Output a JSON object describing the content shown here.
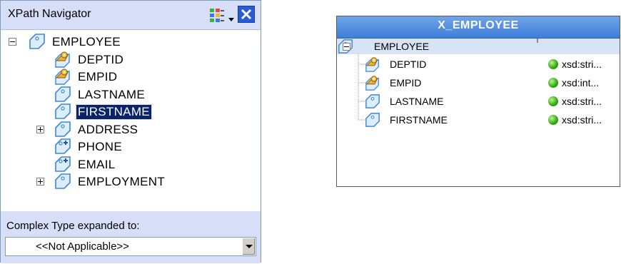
{
  "navigator": {
    "title": "XPath Navigator",
    "tree": [
      {
        "label": "EMPLOYEE",
        "icon": "element-icon",
        "expander": "minus",
        "selected": false
      },
      {
        "label": "DEPTID",
        "icon": "key-attribute-icon",
        "expander": "",
        "selected": false
      },
      {
        "label": "EMPID",
        "icon": "key-attribute-icon",
        "expander": "",
        "selected": false
      },
      {
        "label": "LASTNAME",
        "icon": "element-icon",
        "expander": "",
        "selected": false
      },
      {
        "label": "FIRSTNAME",
        "icon": "element-icon",
        "expander": "",
        "selected": true
      },
      {
        "label": "ADDRESS",
        "icon": "element-icon",
        "expander": "plus",
        "selected": false
      },
      {
        "label": "PHONE",
        "icon": "multi-element-icon",
        "expander": "",
        "selected": false
      },
      {
        "label": "EMAIL",
        "icon": "multi-element-icon",
        "expander": "",
        "selected": false
      },
      {
        "label": "EMPLOYMENT",
        "icon": "element-icon",
        "expander": "plus",
        "selected": false
      }
    ],
    "footer_label": "Complex Type expanded to:",
    "type_select_value": "<<Not Applicable>>"
  },
  "xbox": {
    "title": "X_EMPLOYEE",
    "root": {
      "label": "EMPLOYEE",
      "icon": "element-icon"
    },
    "fields": [
      {
        "label": "DEPTID",
        "icon": "key-attribute-icon",
        "type": "xsd:stri..."
      },
      {
        "label": "EMPID",
        "icon": "key-attribute-icon",
        "type": "xsd:int..."
      },
      {
        "label": "LASTNAME",
        "icon": "element-icon",
        "type": "xsd:stri..."
      },
      {
        "label": "FIRSTNAME",
        "icon": "element-icon",
        "type": "xsd:stri..."
      }
    ]
  },
  "colors": {
    "panel_header": "#d6dff7",
    "selection": "#0a246a",
    "xbox_title": "#3f7fd8",
    "status_green": "#2ea80f"
  }
}
